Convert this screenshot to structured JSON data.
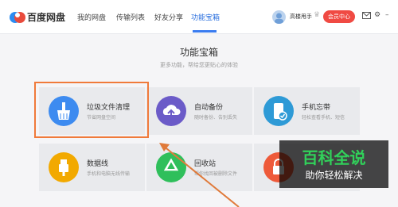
{
  "app": {
    "brand": "百度网盘"
  },
  "tabs": [
    {
      "label": "我的网盘"
    },
    {
      "label": "传输列表"
    },
    {
      "label": "好友分享"
    },
    {
      "label": "功能宝箱"
    }
  ],
  "user": {
    "name": "高楼甩手",
    "vip_label": "会员中心"
  },
  "toolbox": {
    "title": "功能宝箱",
    "subtitle": "更多功能，帮给您更贴心的体验",
    "cards": [
      {
        "title": "垃圾文件清理",
        "desc": "节省网盘空间",
        "icon": "broom-icon",
        "color": "#3d8bf0"
      },
      {
        "title": "自动备份",
        "desc": "随时备份、告别丢失",
        "icon": "cloud-upload-icon",
        "color": "#6b5bc8"
      },
      {
        "title": "手机忘带",
        "desc": "轻松查看手机、短信",
        "icon": "phone-check-icon",
        "color": "#2e9ad6"
      },
      {
        "title": "数据线",
        "desc": "手机和电脑无线传输",
        "icon": "usb-icon",
        "color": "#f2a900"
      },
      {
        "title": "回收站",
        "desc": "帮你找回被删除文件",
        "icon": "recycle-icon",
        "color": "#2fbf5b"
      },
      {
        "title": "",
        "desc": "",
        "icon": "lock-icon",
        "color": "#ee5a3a"
      }
    ]
  },
  "watermark": {
    "line1": "百科全说",
    "line2": "助你轻松解决"
  },
  "colors": {
    "accent": "#3a7cf0",
    "highlight": "#f07a3a",
    "vip": "#f04a43"
  }
}
